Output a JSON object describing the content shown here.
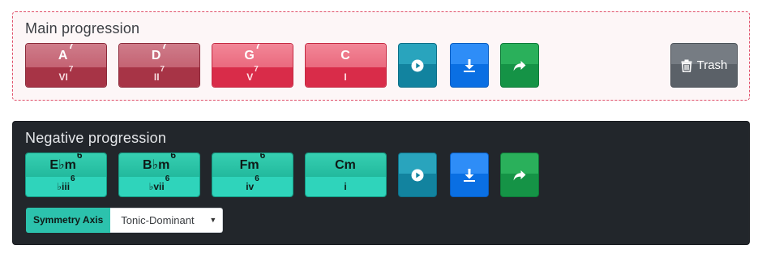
{
  "main": {
    "title": "Main progression",
    "chords": [
      {
        "root": "A",
        "ext": "7",
        "roman": "VI",
        "roman_ext": "7",
        "style": "dark"
      },
      {
        "root": "D",
        "ext": "7",
        "roman": "II",
        "roman_ext": "7",
        "style": "dark"
      },
      {
        "root": "G",
        "ext": "7",
        "roman": "V",
        "roman_ext": "7",
        "style": "red"
      },
      {
        "root": "C",
        "ext": "",
        "roman": "I",
        "roman_ext": "",
        "style": "red"
      }
    ],
    "actions": [
      {
        "name": "play",
        "icon": "play-circle-icon",
        "color": "#12839f"
      },
      {
        "name": "download",
        "icon": "download-icon",
        "color": "#0a6fe3"
      },
      {
        "name": "share",
        "icon": "share-arrow-icon",
        "color": "#159346"
      }
    ],
    "trash_label": "Trash"
  },
  "negative": {
    "title": "Negative progression",
    "chords": [
      {
        "root": "E♭m",
        "ext": "6",
        "roman": "♭iii",
        "roman_ext": "6"
      },
      {
        "root": "B♭m",
        "ext": "6",
        "roman": "♭vii",
        "roman_ext": "6"
      },
      {
        "root": "Fm",
        "ext": "6",
        "roman": "iv",
        "roman_ext": "6"
      },
      {
        "root": "Cm",
        "ext": "",
        "roman": "i",
        "roman_ext": ""
      }
    ],
    "actions": [
      {
        "name": "play",
        "icon": "play-circle-icon",
        "color": "#12839f"
      },
      {
        "name": "download",
        "icon": "download-icon",
        "color": "#0a6fe3"
      },
      {
        "name": "share",
        "icon": "share-arrow-icon",
        "color": "#159346"
      }
    ],
    "symmetry_label": "Symmetry Axis",
    "symmetry_value": "Tonic-Dominant"
  },
  "colors": {
    "main_border": "#e0506a",
    "main_dark_chord": "#a73446",
    "main_red_chord": "#d92c49",
    "negative_bg": "#22262b",
    "negative_chord": "#2fd4bb",
    "trash": "#5b6168"
  }
}
